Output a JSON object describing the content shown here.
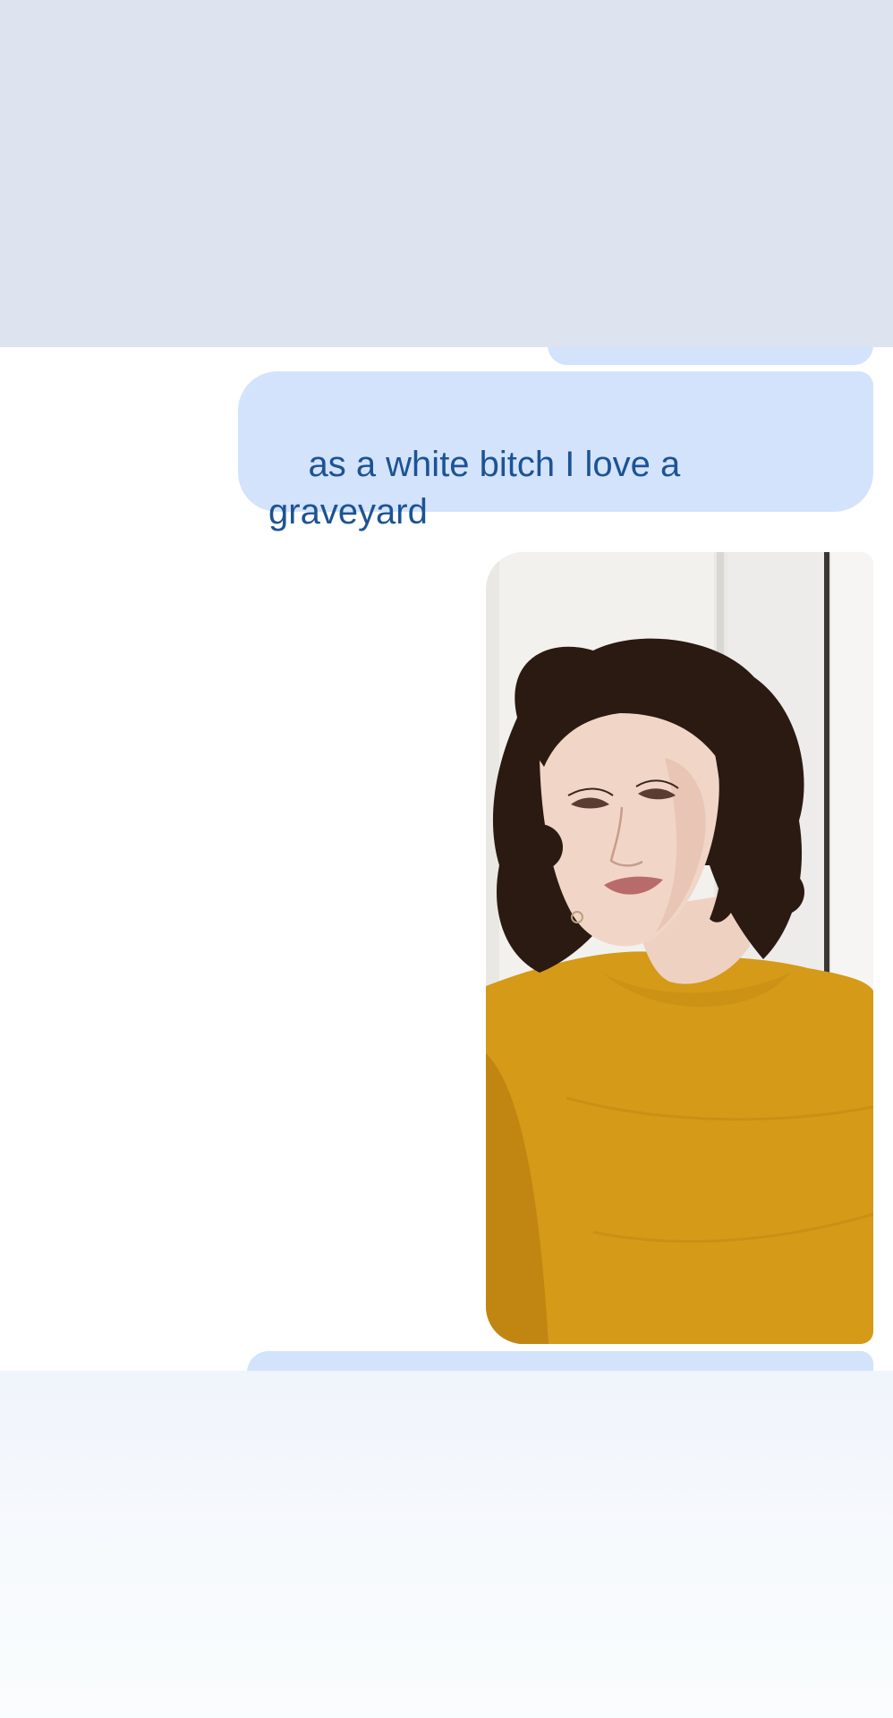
{
  "conversation": {
    "messages": [
      {
        "type": "text",
        "text": "as a white bitch I love a\ngraveyard"
      },
      {
        "type": "image",
        "image_icon": "selfie-photo"
      }
    ]
  },
  "colors": {
    "top_panel": "#dde4f0",
    "bubble": "#d3e3fc",
    "bubble_text": "#1d5395",
    "background": "#ffffff",
    "sweater": "#d49a18",
    "hair": "#2b1a12"
  }
}
